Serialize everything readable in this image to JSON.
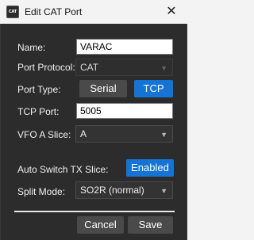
{
  "window": {
    "icon_text": "CAT",
    "title": "Edit CAT Port",
    "close_glyph": "✕"
  },
  "form": {
    "name": {
      "label": "Name:",
      "value": "VARAC"
    },
    "port_protocol": {
      "label": "Port Protocol:",
      "value": "CAT",
      "enabled": false
    },
    "port_type": {
      "label": "Port Type:",
      "options": [
        "Serial",
        "TCP"
      ],
      "selected": "TCP"
    },
    "tcp_port": {
      "label": "TCP Port:",
      "value": "5005"
    },
    "vfo_a_slice": {
      "label": "VFO A Slice:",
      "value": "A"
    },
    "auto_switch_tx_slice": {
      "label": "Auto Switch TX Slice:",
      "button_label": "Enabled"
    },
    "split_mode": {
      "label": "Split Mode:",
      "value": "SO2R (normal)"
    }
  },
  "actions": {
    "cancel_label": "Cancel",
    "save_label": "Save"
  },
  "colors": {
    "panel_bg": "#2c2c2c",
    "accent_blue": "#1573d6",
    "button_gray": "#4a4a4a"
  },
  "icons": {
    "dropdown": "chevron-down-icon",
    "close": "close-icon",
    "app": "cat-app-icon"
  }
}
